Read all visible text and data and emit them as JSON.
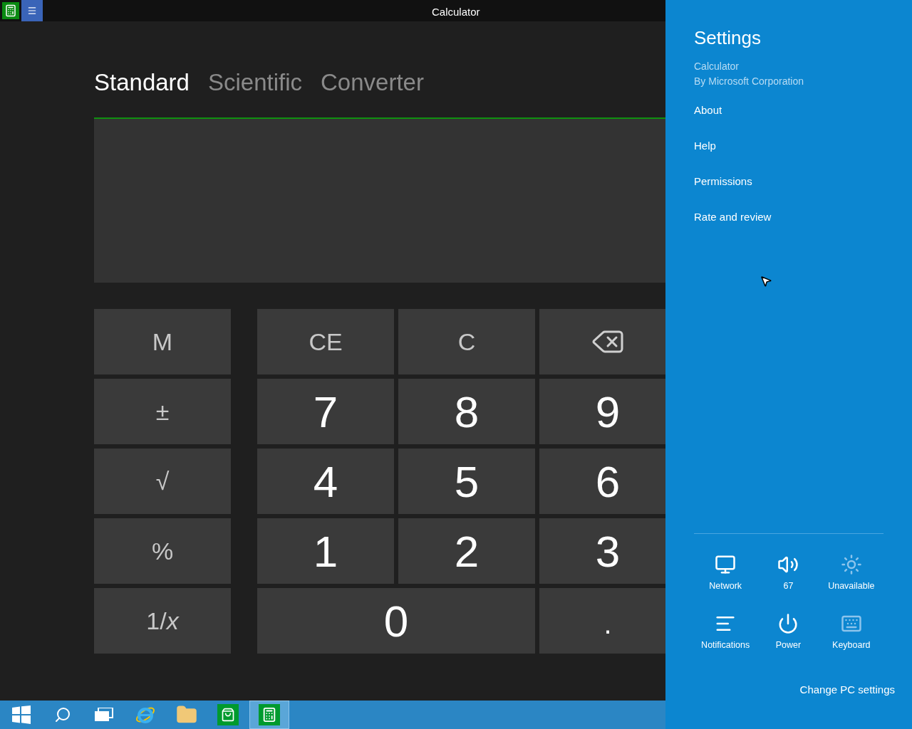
{
  "window": {
    "title": "Calculator"
  },
  "tabs": [
    {
      "label": "Standard",
      "selected": true
    },
    {
      "label": "Scientific",
      "selected": false
    },
    {
      "label": "Converter",
      "selected": false
    }
  ],
  "memory_keys": [
    {
      "label": "M",
      "kind": "function"
    },
    {
      "label": "±",
      "kind": "function"
    },
    {
      "label": "√",
      "kind": "function"
    },
    {
      "label": "%",
      "kind": "function"
    },
    {
      "label": "1/*x*",
      "kind": "function"
    }
  ],
  "keypad": [
    {
      "label": "CE",
      "kind": "function"
    },
    {
      "label": "C",
      "kind": "function"
    },
    {
      "kind": "backspace"
    },
    {
      "label": "7",
      "kind": "digit"
    },
    {
      "label": "8",
      "kind": "digit"
    },
    {
      "label": "9",
      "kind": "digit"
    },
    {
      "label": "4",
      "kind": "digit"
    },
    {
      "label": "5",
      "kind": "digit"
    },
    {
      "label": "6",
      "kind": "digit"
    },
    {
      "label": "1",
      "kind": "digit"
    },
    {
      "label": "2",
      "kind": "digit"
    },
    {
      "label": "3",
      "kind": "digit"
    },
    {
      "label": "0",
      "kind": "zero"
    },
    {
      "label": ".",
      "kind": "point"
    }
  ],
  "settings": {
    "title": "Settings",
    "app_name": "Calculator",
    "publisher": "By Microsoft Corporation",
    "links": [
      "About",
      "Help",
      "Permissions",
      "Rate and review"
    ],
    "quick_settings": [
      {
        "kind": "network",
        "label": "Network"
      },
      {
        "kind": "volume",
        "label": "67"
      },
      {
        "kind": "brightness",
        "label": "Unavailable"
      },
      {
        "kind": "notifications",
        "label": "Notifications"
      },
      {
        "kind": "power",
        "label": "Power"
      },
      {
        "kind": "keyboard",
        "label": "Keyboard"
      }
    ],
    "change_pc_settings": "Change PC settings"
  },
  "taskbar": [
    {
      "kind": "start",
      "selected": false
    },
    {
      "kind": "search",
      "selected": false
    },
    {
      "kind": "taskview",
      "selected": false
    },
    {
      "kind": "browser",
      "selected": false
    },
    {
      "kind": "explorer",
      "selected": false
    },
    {
      "kind": "store",
      "selected": false
    },
    {
      "kind": "calculator",
      "selected": true
    }
  ]
}
